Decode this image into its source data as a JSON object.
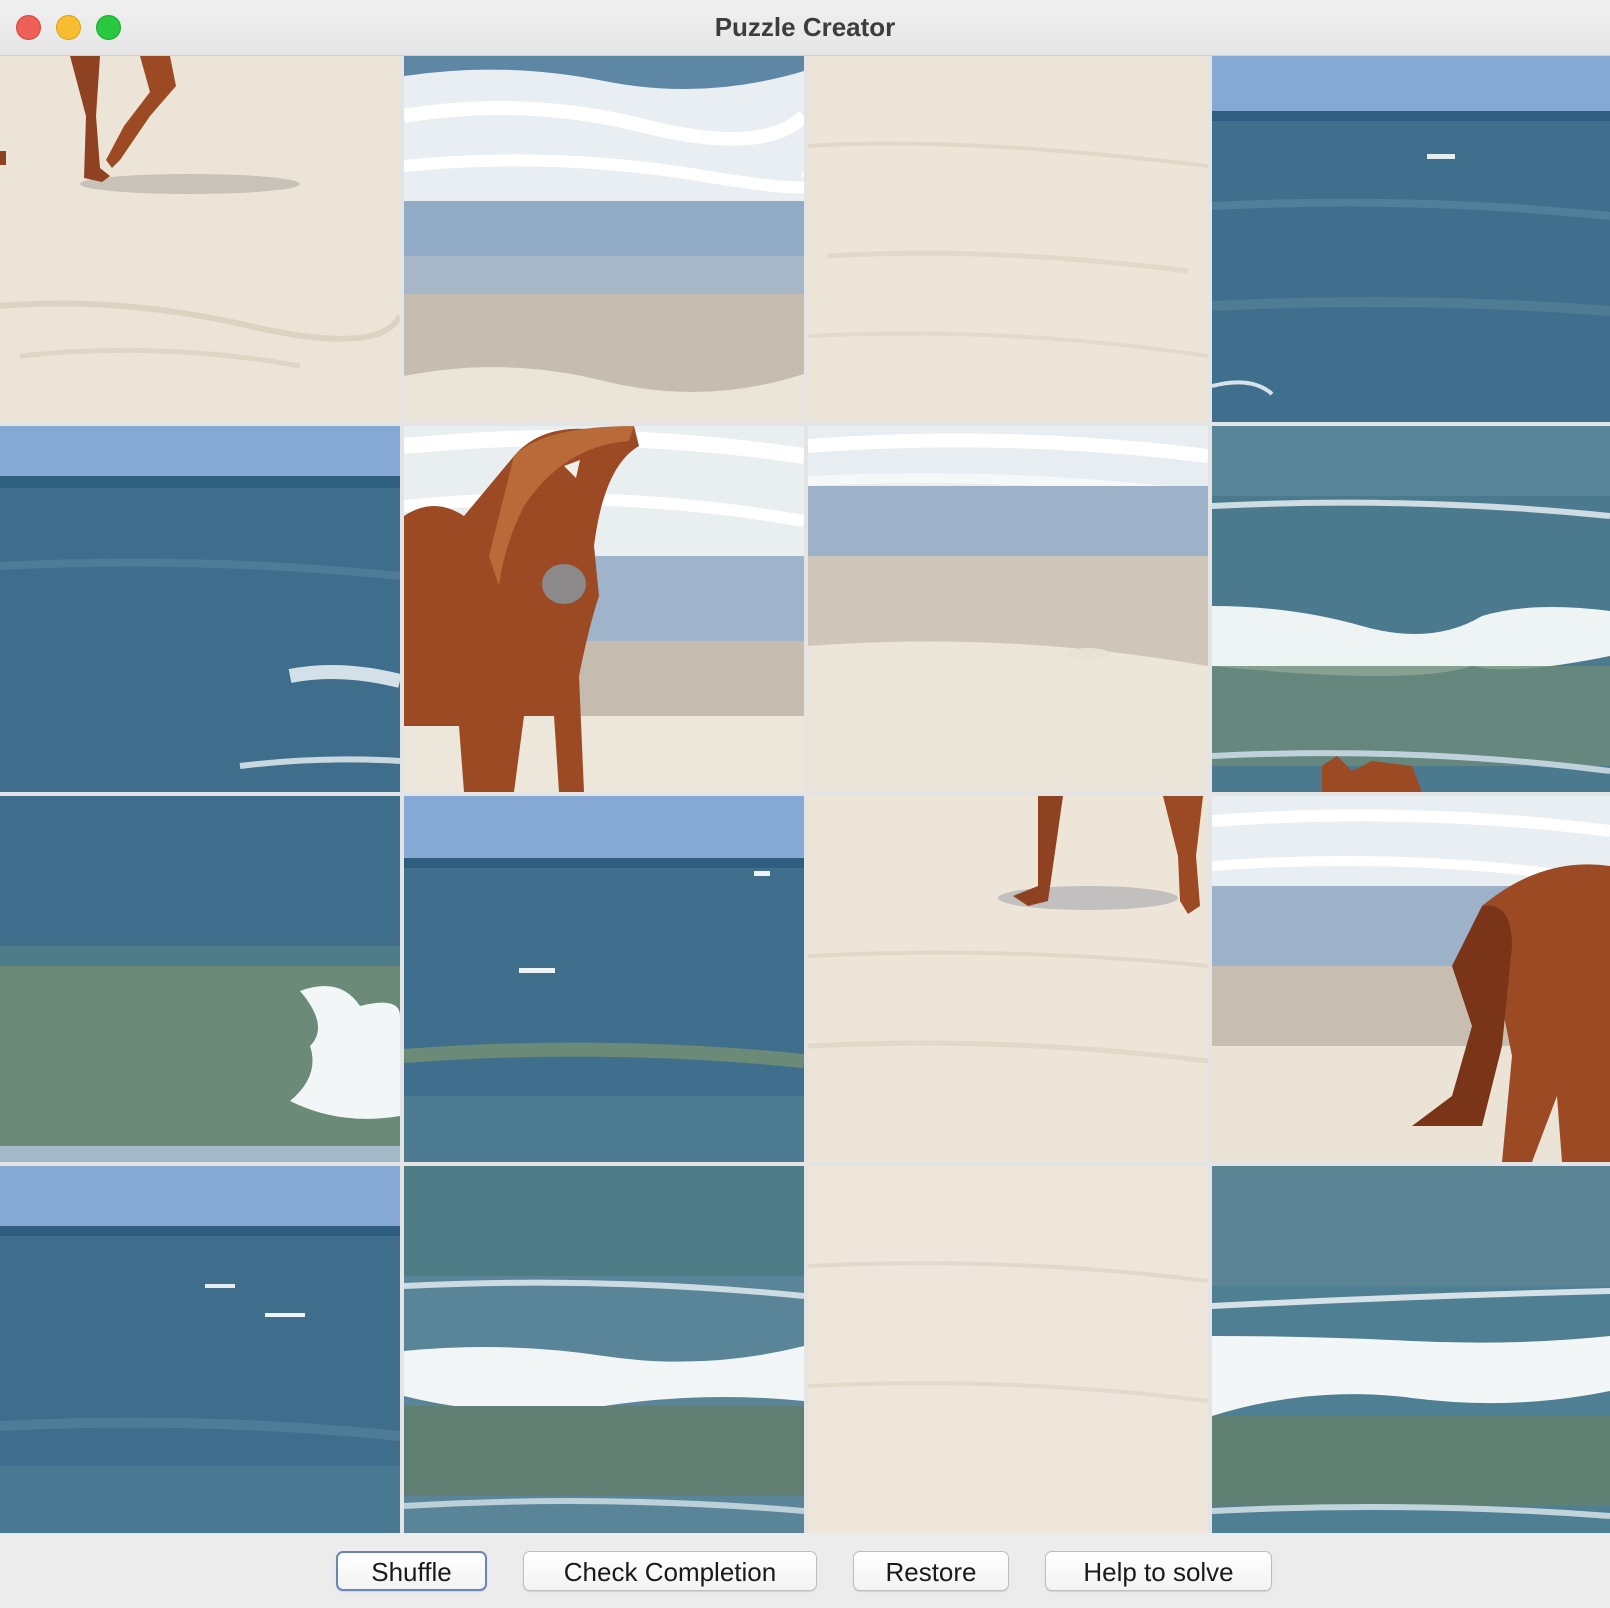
{
  "window": {
    "title": "Puzzle Creator",
    "controls": [
      "close",
      "minimize",
      "zoom"
    ]
  },
  "puzzle": {
    "rows": 4,
    "columns": 4,
    "image_subject": "horse on beach",
    "tiles": [
      [
        "horse-legs-sand",
        "surf-shore",
        "plain-sand",
        "sky-sea"
      ],
      [
        "sky-sea",
        "horse-head-shore",
        "surf-shore-sand",
        "sea-wave-horse-ears"
      ],
      [
        "sea-wave-curl",
        "sky-sea",
        "horse-legs-shadow",
        "horse-rear-shore"
      ],
      [
        "sky-sea",
        "sea-wave",
        "plain-sand",
        "sea-wave"
      ]
    ]
  },
  "toolbar": {
    "shuffle_label": "Shuffle",
    "check_label": "Check Completion",
    "restore_label": "Restore",
    "help_label": "Help to solve"
  },
  "colors": {
    "sky": "#86a8d4",
    "sea": "#3f6f8d",
    "sea_green": "#6b8b78",
    "foam": "#f4f7f8",
    "sand": "#ece4d7",
    "wet_sand": "#c9c0b2",
    "horse": "#9c4a24",
    "focus_ring": "#6a86b7"
  }
}
